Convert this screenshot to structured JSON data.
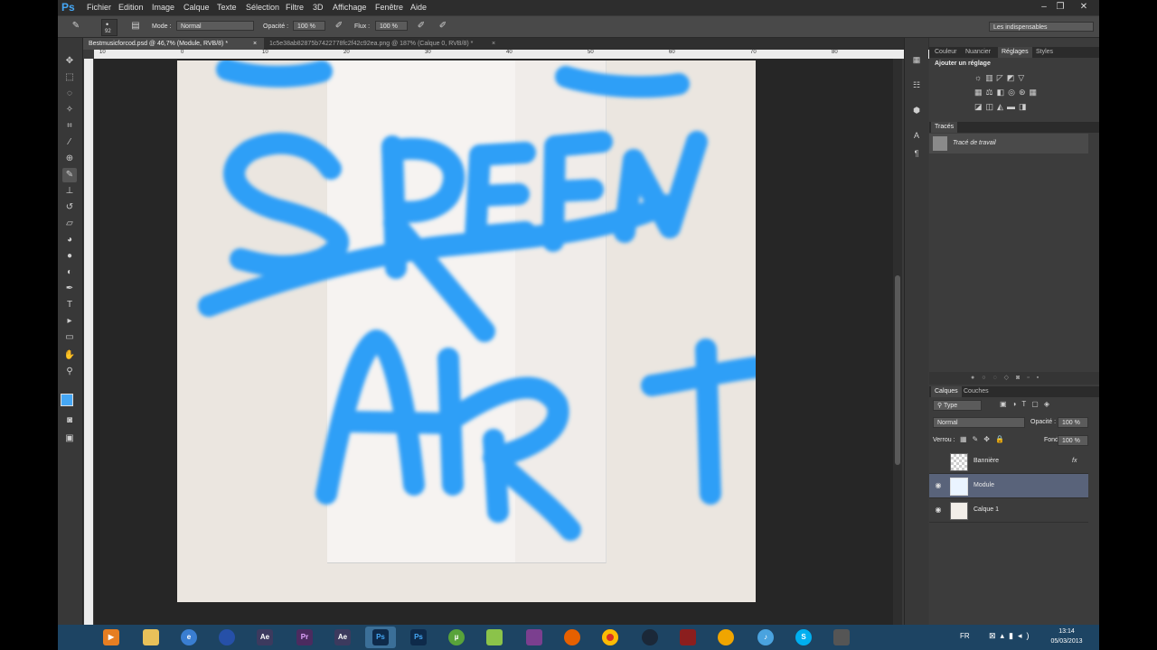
{
  "menu": {
    "logo": "Ps",
    "items": [
      "Fichier",
      "Edition",
      "Image",
      "Calque",
      "Texte",
      "Sélection",
      "Filtre",
      "3D",
      "Affichage",
      "Fenêtre",
      "Aide"
    ]
  },
  "options": {
    "brush_size": "92",
    "mode_label": "Mode :",
    "mode_value": "Normal",
    "opacity_label": "Opacité :",
    "opacity_value": "100 %",
    "flow_label": "Flux :",
    "flow_value": "100 %",
    "workspace": "Les indispensables"
  },
  "tabs": [
    {
      "label": "Bestmusicforcod.psd @ 46,7% (Module, RVB/8) *",
      "active": true
    },
    {
      "label": "1c5e38ab82875b7422778fc2f42c92ea.png @ 187% (Calque 0, RVB/8) *",
      "active": false
    }
  ],
  "ruler_top": [
    "10",
    "0",
    "10",
    "20",
    "30",
    "40",
    "50",
    "60",
    "70",
    "80",
    "90"
  ],
  "panels": {
    "top_tabs": [
      "Couleur",
      "Nuancier",
      "Réglages",
      "Styles"
    ],
    "top_active": "Réglages",
    "adjust_title": "Ajouter un réglage",
    "paths_tab": "Tracés",
    "path_item": "Tracé de travail",
    "layers_tabs": [
      "Calques",
      "Couches"
    ],
    "layers_active": "Calques",
    "filter_kind": "Type",
    "blend_mode": "Normal",
    "opacity_label": "Opacité :",
    "opacity_value": "100 %",
    "lock_label": "Verrou :",
    "fill_label": "Fond :",
    "fill_value": "100 %",
    "layers": [
      {
        "name": "Bannière",
        "visible": false,
        "selected": false,
        "fx": "fx"
      },
      {
        "name": "Module",
        "visible": true,
        "selected": true,
        "fx": ""
      },
      {
        "name": "Calque 1",
        "visible": true,
        "selected": false,
        "fx": ""
      }
    ]
  },
  "taskbar": {
    "lang": "FR",
    "time": "13:14",
    "date": "05/03/2013",
    "apps": [
      "media-player",
      "explorer",
      "ie-like",
      "firefox-blue",
      "Ae",
      "Pr",
      "Ae",
      "Ps",
      "Ps",
      "utorrent",
      "notepad",
      "winrar",
      "firefox",
      "chrome",
      "steam",
      "app-red",
      "headphones",
      "itunes",
      "skype",
      "app-gray"
    ]
  },
  "colors": {
    "accent": "#45a7f5",
    "stroke": "#2f9ff7",
    "taskbar": "#1d4463"
  }
}
